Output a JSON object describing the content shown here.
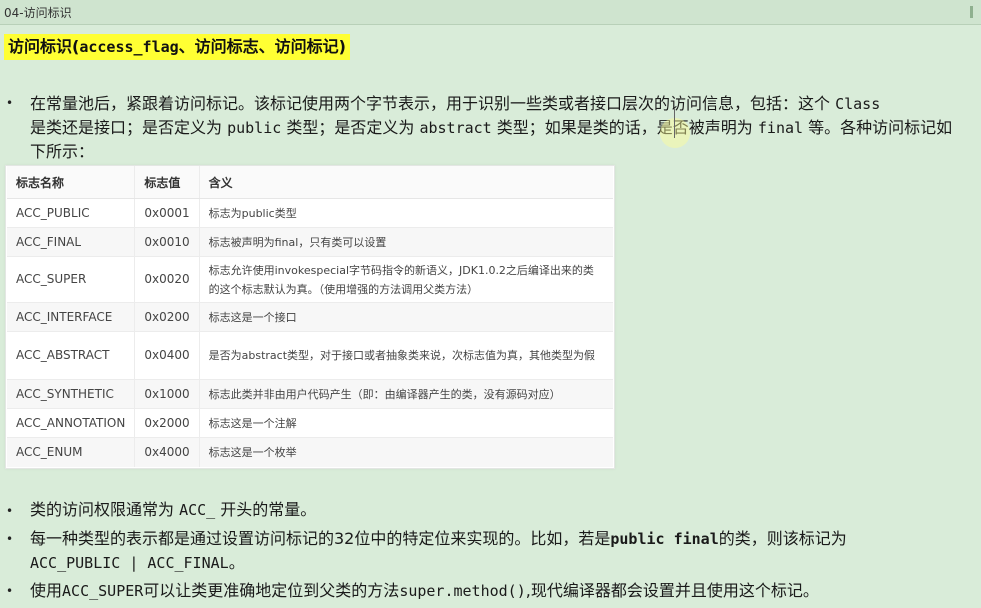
{
  "window": {
    "title": "04-访问标识"
  },
  "heading": {
    "prefix": "访问标识(",
    "mono": "access_flag",
    "suffix": "、访问标志、访问标记)"
  },
  "para1": {
    "t1": "在常量池后，紧跟着访问标记。该标记使用两个字节表示，用于识别一些类或者接口层次的访问信息，包括：这个 ",
    "c1": "Class",
    "t2": "是类还是接口；是否定义为 ",
    "c2": "public",
    "t3": " 类型；是否定义为 ",
    "c3": "abstract",
    "t4": " 类型；如果是类的话，是否被声明为 ",
    "c4": "final",
    "t5": " 等。各种访问标记如下所示："
  },
  "table": {
    "headers": [
      "标志名称",
      "标志值",
      "含义"
    ],
    "rows": [
      {
        "name": "ACC_PUBLIC",
        "value": "0x0001",
        "meaning": "标志为public类型"
      },
      {
        "name": "ACC_FINAL",
        "value": "0x0010",
        "meaning": "标志被声明为final，只有类可以设置"
      },
      {
        "name": "ACC_SUPER",
        "value": "0x0020",
        "meaning": "标志允许使用invokespecial字节码指令的新语义，JDK1.0.2之后编译出来的类的这个标志默认为真。（使用增强的方法调用父类方法）"
      },
      {
        "name": "ACC_INTERFACE",
        "value": "0x0200",
        "meaning": "标志这是一个接口"
      },
      {
        "name": "ACC_ABSTRACT",
        "value": "0x0400",
        "meaning": "是否为abstract类型，对于接口或者抽象类来说，次标志值为真，其他类型为假"
      },
      {
        "name": "ACC_SYNTHETIC",
        "value": "0x1000",
        "meaning": "标志此类并非由用户代码产生（即：由编译器产生的类，没有源码对应）"
      },
      {
        "name": "ACC_ANNOTATION",
        "value": "0x2000",
        "meaning": "标志这是一个注解"
      },
      {
        "name": "ACC_ENUM",
        "value": "0x4000",
        "meaning": "标志这是一个枚举"
      }
    ]
  },
  "bullets": {
    "b1": {
      "t1": "类的访问权限通常为 ",
      "c1": "ACC_",
      "t2": " 开头的常量。"
    },
    "b2": {
      "t1": "每一种类型的表示都是通过设置访问标记的32位中的特定位来实现的。比如，若是",
      "c1": "public final",
      "t2": "的类，则该标记为",
      "c2": "ACC_PUBLIC | ACC_FINAL",
      "t3": "。"
    },
    "b3": {
      "t1": "使用",
      "c1": "ACC_SUPER",
      "t2": "可以让类更准确地定位到父类的方法",
      "c2": "super.method()",
      "t3": ",现代编译器都会设置并且使用这个标记。"
    },
    "marker": "•"
  },
  "colors": {
    "background": "#d9ecd9",
    "highlight": "#ffff33"
  }
}
